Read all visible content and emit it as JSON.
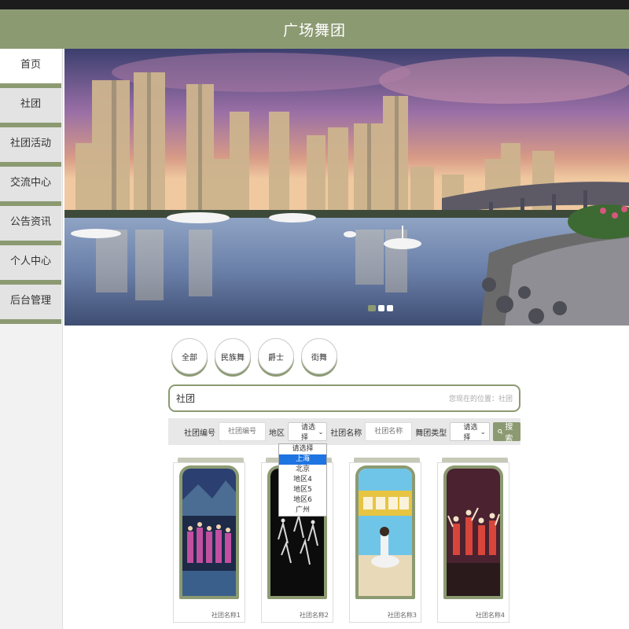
{
  "header": {
    "title": "广场舞团"
  },
  "sidebar": {
    "items": [
      {
        "label": "首页"
      },
      {
        "label": "社团"
      },
      {
        "label": "社团活动"
      },
      {
        "label": "交流中心"
      },
      {
        "label": "公告资讯"
      },
      {
        "label": "个人中心"
      },
      {
        "label": "后台管理"
      }
    ]
  },
  "filters": [
    "全部",
    "民族舞",
    "爵士",
    "街舞"
  ],
  "location": {
    "title": "社团",
    "path": "您现在的位置：社团"
  },
  "search": {
    "code_label": "社团编号",
    "code_placeholder": "社团编号",
    "region_label": "地区",
    "region_value": "请选择",
    "name_label": "社团名称",
    "name_placeholder": "社团名称",
    "type_label": "舞团类型",
    "type_value": "请选择",
    "button": "搜索"
  },
  "region_options": [
    "请选择",
    "上海",
    "北京",
    "地区4",
    "地区5",
    "地区6",
    "广州"
  ],
  "region_highlight": "上海",
  "cards": [
    {
      "name": "社团名称1"
    },
    {
      "name": "社团名称2"
    },
    {
      "name": "社团名称3"
    },
    {
      "name": "社团名称4"
    }
  ],
  "colors": {
    "accent": "#8c9a72",
    "highlight": "#1e74e0"
  }
}
